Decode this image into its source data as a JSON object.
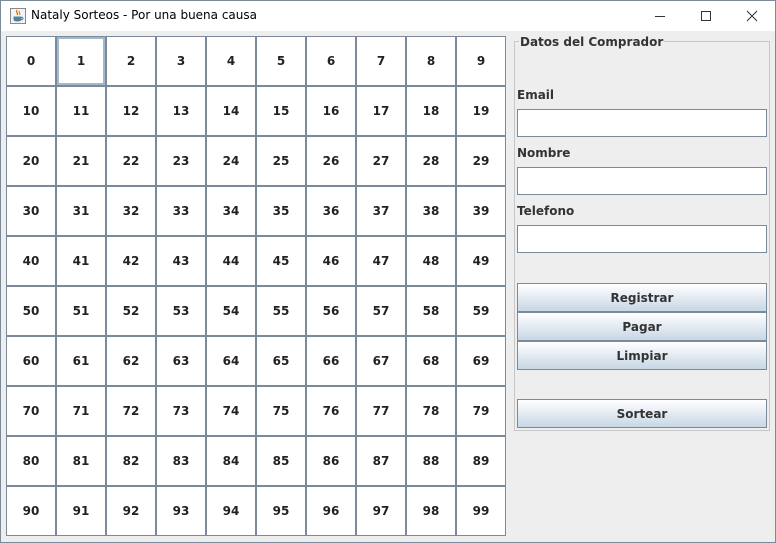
{
  "window": {
    "title": "Nataly Sorteos - Por una buena causa",
    "icon": "java-cup-icon",
    "controls": [
      "minimize-icon",
      "maximize-icon",
      "close-icon"
    ]
  },
  "numbers": [
    "0",
    "1",
    "2",
    "3",
    "4",
    "5",
    "6",
    "7",
    "8",
    "9",
    "10",
    "11",
    "12",
    "13",
    "14",
    "15",
    "16",
    "17",
    "18",
    "19",
    "20",
    "21",
    "22",
    "23",
    "24",
    "25",
    "26",
    "27",
    "28",
    "29",
    "30",
    "31",
    "32",
    "33",
    "34",
    "35",
    "36",
    "37",
    "38",
    "39",
    "40",
    "41",
    "42",
    "43",
    "44",
    "45",
    "46",
    "47",
    "48",
    "49",
    "50",
    "51",
    "52",
    "53",
    "54",
    "55",
    "56",
    "57",
    "58",
    "59",
    "60",
    "61",
    "62",
    "63",
    "64",
    "65",
    "66",
    "67",
    "68",
    "69",
    "70",
    "71",
    "72",
    "73",
    "74",
    "75",
    "76",
    "77",
    "78",
    "79",
    "80",
    "81",
    "82",
    "83",
    "84",
    "85",
    "86",
    "87",
    "88",
    "89",
    "90",
    "91",
    "92",
    "93",
    "94",
    "95",
    "96",
    "97",
    "98",
    "99"
  ],
  "focused_number": "1",
  "buyer_panel": {
    "title": "Datos del Comprador",
    "email_label": "Email",
    "email_value": "",
    "nombre_label": "Nombre",
    "nombre_value": "",
    "telefono_label": "Telefono",
    "telefono_value": ""
  },
  "actions": {
    "registrar": "Registrar",
    "pagar": "Pagar",
    "limpiar": "Limpiar",
    "sortear": "Sortear"
  }
}
